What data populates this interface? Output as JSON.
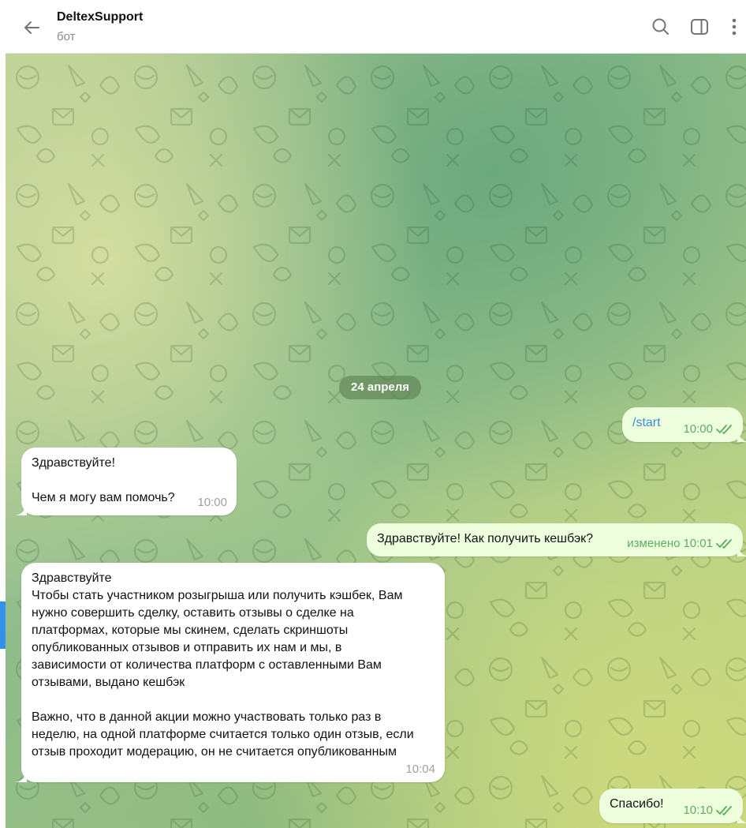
{
  "header": {
    "title": "DeltexSupport",
    "subtitle": "бот"
  },
  "date_separator": "24 апреля",
  "messages": [
    {
      "direction": "out",
      "text": "/start",
      "time": "10:00",
      "edited_label": "",
      "read": true
    },
    {
      "direction": "in",
      "text": "Здравствуйте!\n\nЧем я могу вам помочь?",
      "time": "10:00"
    },
    {
      "direction": "out",
      "text": "Здравствуйте! Как получить кешбэк?",
      "time": "10:01",
      "edited_label": "изменено",
      "read": true
    },
    {
      "direction": "in",
      "text": "Здравствуйте\nЧтобы стать участником розыгрыша или получить кэшбек, Вам\nнужно совершить сделку, оставить отзывы о сделке на\nплатформах, которые мы скинем, сделать скриншоты\nопубликованных отзывов и отправить их нам и мы, в\nзависимости от количества платформ с оставленными Вам\nотзывами, выдано кешбэк\n\nВажно, что в данной акции можно участвовать только раз в\nнеделю, на одной платформе считается только один отзыв, если\nотзыв проходит модерацию, он не считается опубликованным",
      "time": "10:04"
    },
    {
      "direction": "out",
      "text": "Спасибо!",
      "time": "10:10",
      "edited_label": "",
      "read": true
    }
  ],
  "colors": {
    "incoming_bubble": "#ffffff",
    "outgoing_bubble": "#eeffde",
    "read_check": "#5bae5d",
    "link": "#3a8bd6"
  },
  "icons": [
    "back-arrow-icon",
    "search-icon",
    "side-panel-icon",
    "more-vertical-icon",
    "double-check-icon"
  ]
}
